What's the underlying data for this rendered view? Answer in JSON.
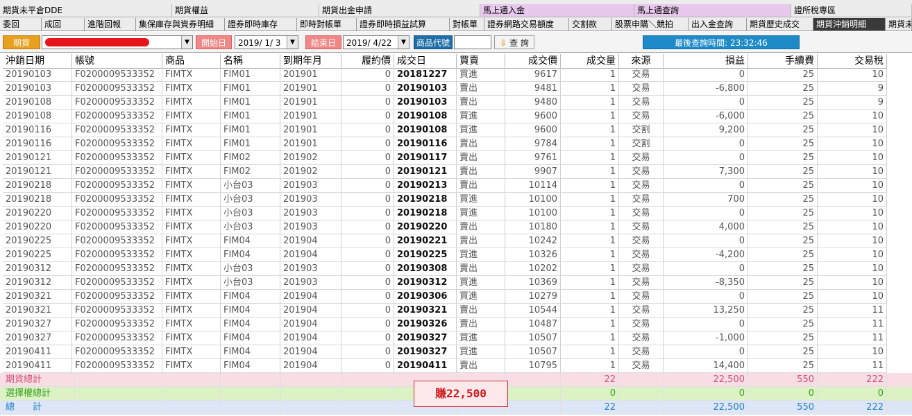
{
  "tabs_row1": [
    {
      "label": "期貨未平倉DDE",
      "pink": false
    },
    {
      "label": "期貨權益",
      "pink": false
    },
    {
      "label": "期貨出金申請",
      "pink": false
    },
    {
      "label": "馬上通入金",
      "pink": true
    },
    {
      "label": "馬上通查詢",
      "pink": true
    },
    {
      "label": "證所稅專區",
      "pink": false
    }
  ],
  "tabs_row2": [
    {
      "label": "委回",
      "active": false
    },
    {
      "label": "成回",
      "active": false
    },
    {
      "label": "進階回報",
      "active": false
    },
    {
      "label": "集保庫存與資券明細",
      "active": false
    },
    {
      "label": "證券即時庫存",
      "active": false
    },
    {
      "label": "即時對帳單",
      "active": false
    },
    {
      "label": "證券即時損益試算",
      "active": false
    },
    {
      "label": "對帳單",
      "active": false
    },
    {
      "label": "證券網路交易額度",
      "active": false
    },
    {
      "label": "交割款",
      "active": false
    },
    {
      "label": "股票申購＼競拍",
      "active": false
    },
    {
      "label": "出入金查詢",
      "active": false
    },
    {
      "label": "期貨歷史成交",
      "active": false
    },
    {
      "label": "期貨沖銷明細",
      "active": true
    },
    {
      "label": "期貨未",
      "active": false
    }
  ],
  "toolbar": {
    "category": "期貨",
    "start_label": "開始日",
    "start_date": "2019/ 1/ 3",
    "end_label": "結束日",
    "end_date": "2019/ 4/22",
    "product_label": "商品代號",
    "product_value": "",
    "query_label": "查 詢",
    "last_query": "最後查詢時間: 23:32:46"
  },
  "columns": [
    "沖銷日期",
    "帳號",
    "商品",
    "名稱",
    "到期年月",
    "履約價",
    "成交日",
    "買賣",
    "成交價",
    "成交量",
    "來源",
    "損益",
    "手續費",
    "交易稅"
  ],
  "rows": [
    [
      "20190103",
      "F0200009533352",
      "FIMTX",
      "FIM01",
      "201901",
      "0",
      "20181227",
      "買進",
      "9617",
      "1",
      "交易",
      "0",
      "25",
      "10"
    ],
    [
      "20190103",
      "F0200009533352",
      "FIMTX",
      "FIM01",
      "201901",
      "0",
      "20190103",
      "賣出",
      "9481",
      "1",
      "交易",
      "-6,800",
      "25",
      "9"
    ],
    [
      "20190108",
      "F0200009533352",
      "FIMTX",
      "FIM01",
      "201901",
      "0",
      "20190103",
      "賣出",
      "9480",
      "1",
      "交易",
      "0",
      "25",
      "9"
    ],
    [
      "20190108",
      "F0200009533352",
      "FIMTX",
      "FIM01",
      "201901",
      "0",
      "20190108",
      "買進",
      "9600",
      "1",
      "交易",
      "-6,000",
      "25",
      "10"
    ],
    [
      "20190116",
      "F0200009533352",
      "FIMTX",
      "FIM01",
      "201901",
      "0",
      "20190108",
      "買進",
      "9600",
      "1",
      "交割",
      "9,200",
      "25",
      "10"
    ],
    [
      "20190116",
      "F0200009533352",
      "FIMTX",
      "FIM01",
      "201901",
      "0",
      "20190116",
      "賣出",
      "9784",
      "1",
      "交割",
      "0",
      "25",
      "10"
    ],
    [
      "20190121",
      "F0200009533352",
      "FIMTX",
      "FIM02",
      "201902",
      "0",
      "20190117",
      "賣出",
      "9761",
      "1",
      "交易",
      "0",
      "25",
      "10"
    ],
    [
      "20190121",
      "F0200009533352",
      "FIMTX",
      "FIM02",
      "201902",
      "0",
      "20190121",
      "賣出",
      "9907",
      "1",
      "交易",
      "7,300",
      "25",
      "10"
    ],
    [
      "20190218",
      "F0200009533352",
      "FIMTX",
      "小台03",
      "201903",
      "0",
      "20190213",
      "賣出",
      "10114",
      "1",
      "交易",
      "0",
      "25",
      "10"
    ],
    [
      "20190218",
      "F0200009533352",
      "FIMTX",
      "小台03",
      "201903",
      "0",
      "20190218",
      "買進",
      "10100",
      "1",
      "交易",
      "700",
      "25",
      "10"
    ],
    [
      "20190220",
      "F0200009533352",
      "FIMTX",
      "小台03",
      "201903",
      "0",
      "20190218",
      "買進",
      "10100",
      "1",
      "交易",
      "0",
      "25",
      "10"
    ],
    [
      "20190220",
      "F0200009533352",
      "FIMTX",
      "小台03",
      "201903",
      "0",
      "20190220",
      "賣出",
      "10180",
      "1",
      "交易",
      "4,000",
      "25",
      "10"
    ],
    [
      "20190225",
      "F0200009533352",
      "FIMTX",
      "FIM04",
      "201904",
      "0",
      "20190221",
      "賣出",
      "10242",
      "1",
      "交易",
      "0",
      "25",
      "10"
    ],
    [
      "20190225",
      "F0200009533352",
      "FIMTX",
      "FIM04",
      "201904",
      "0",
      "20190225",
      "買進",
      "10326",
      "1",
      "交易",
      "-4,200",
      "25",
      "10"
    ],
    [
      "20190312",
      "F0200009533352",
      "FIMTX",
      "小台03",
      "201903",
      "0",
      "20190308",
      "賣出",
      "10202",
      "1",
      "交易",
      "0",
      "25",
      "10"
    ],
    [
      "20190312",
      "F0200009533352",
      "FIMTX",
      "小台03",
      "201903",
      "0",
      "20190312",
      "買進",
      "10369",
      "1",
      "交易",
      "-8,350",
      "25",
      "10"
    ],
    [
      "20190321",
      "F0200009533352",
      "FIMTX",
      "FIM04",
      "201904",
      "0",
      "20190306",
      "買進",
      "10279",
      "1",
      "交易",
      "0",
      "25",
      "10"
    ],
    [
      "20190321",
      "F0200009533352",
      "FIMTX",
      "FIM04",
      "201904",
      "0",
      "20190321",
      "賣出",
      "10544",
      "1",
      "交易",
      "13,250",
      "25",
      "11"
    ],
    [
      "20190327",
      "F0200009533352",
      "FIMTX",
      "FIM04",
      "201904",
      "0",
      "20190326",
      "賣出",
      "10487",
      "1",
      "交易",
      "0",
      "25",
      "11"
    ],
    [
      "20190327",
      "F0200009533352",
      "FIMTX",
      "FIM04",
      "201904",
      "0",
      "20190327",
      "買進",
      "10507",
      "1",
      "交易",
      "-1,000",
      "25",
      "11"
    ],
    [
      "20190411",
      "F0200009533352",
      "FIMTX",
      "FIM04",
      "201904",
      "0",
      "20190327",
      "買進",
      "10507",
      "1",
      "交易",
      "0",
      "25",
      "10"
    ],
    [
      "20190411",
      "F0200009533352",
      "FIMTX",
      "FIM04",
      "201904",
      "0",
      "20190411",
      "賣出",
      "10795",
      "1",
      "交易",
      "14,400",
      "25",
      "11"
    ]
  ],
  "summary": {
    "futures": {
      "label": "期貨總計",
      "volume": "22",
      "pnl": "22,500",
      "fee": "550",
      "tax": "222"
    },
    "options": {
      "label": "選擇權總計",
      "volume": "0",
      "pnl": "0",
      "fee": "0",
      "tax": "0"
    },
    "total": {
      "label": "總　　計",
      "volume": "22",
      "pnl": "22,500",
      "fee": "550",
      "tax": "222"
    }
  },
  "annotation": "賺22,500",
  "colors": {
    "active_tab": "#3a3a3a",
    "futures_badge": "#e8a020",
    "date_label": "#f08888",
    "product_label": "#1e6ea8",
    "last_query_bg": "#1e8ac8",
    "annotation": "#d01818"
  }
}
